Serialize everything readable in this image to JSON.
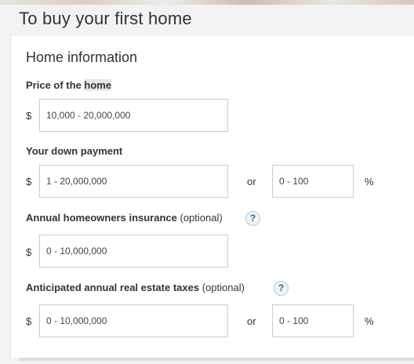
{
  "header": {
    "title": "To buy your first home"
  },
  "form": {
    "section_title": "Home information",
    "price": {
      "label_prefix": "Price of the ",
      "label_highlight": "home",
      "currency": "$",
      "placeholder": "10,000 - 20,000,000"
    },
    "down_payment": {
      "label": "Your down payment",
      "currency": "$",
      "amount_placeholder": "1 - 20,000,000",
      "or_label": "or",
      "percent_placeholder": "0 - 100",
      "percent_sign": "%"
    },
    "insurance": {
      "label": "Annual homeowners insurance",
      "optional": "(optional)",
      "help_glyph": "?",
      "currency": "$",
      "placeholder": "0 - 10,000,000"
    },
    "taxes": {
      "label": "Anticipated annual real estate taxes",
      "optional": "(optional)",
      "help_glyph": "?",
      "currency": "$",
      "amount_placeholder": "0 - 10,000,000",
      "or_label": "or",
      "percent_placeholder": "0 - 100",
      "percent_sign": "%"
    }
  },
  "colors": {
    "page_background": "#f2f2f2",
    "card_background": "#ffffff",
    "input_border": "#cccccc",
    "help_icon_accent": "#2f6e9c"
  },
  "icons": {
    "help": "help-icon"
  }
}
